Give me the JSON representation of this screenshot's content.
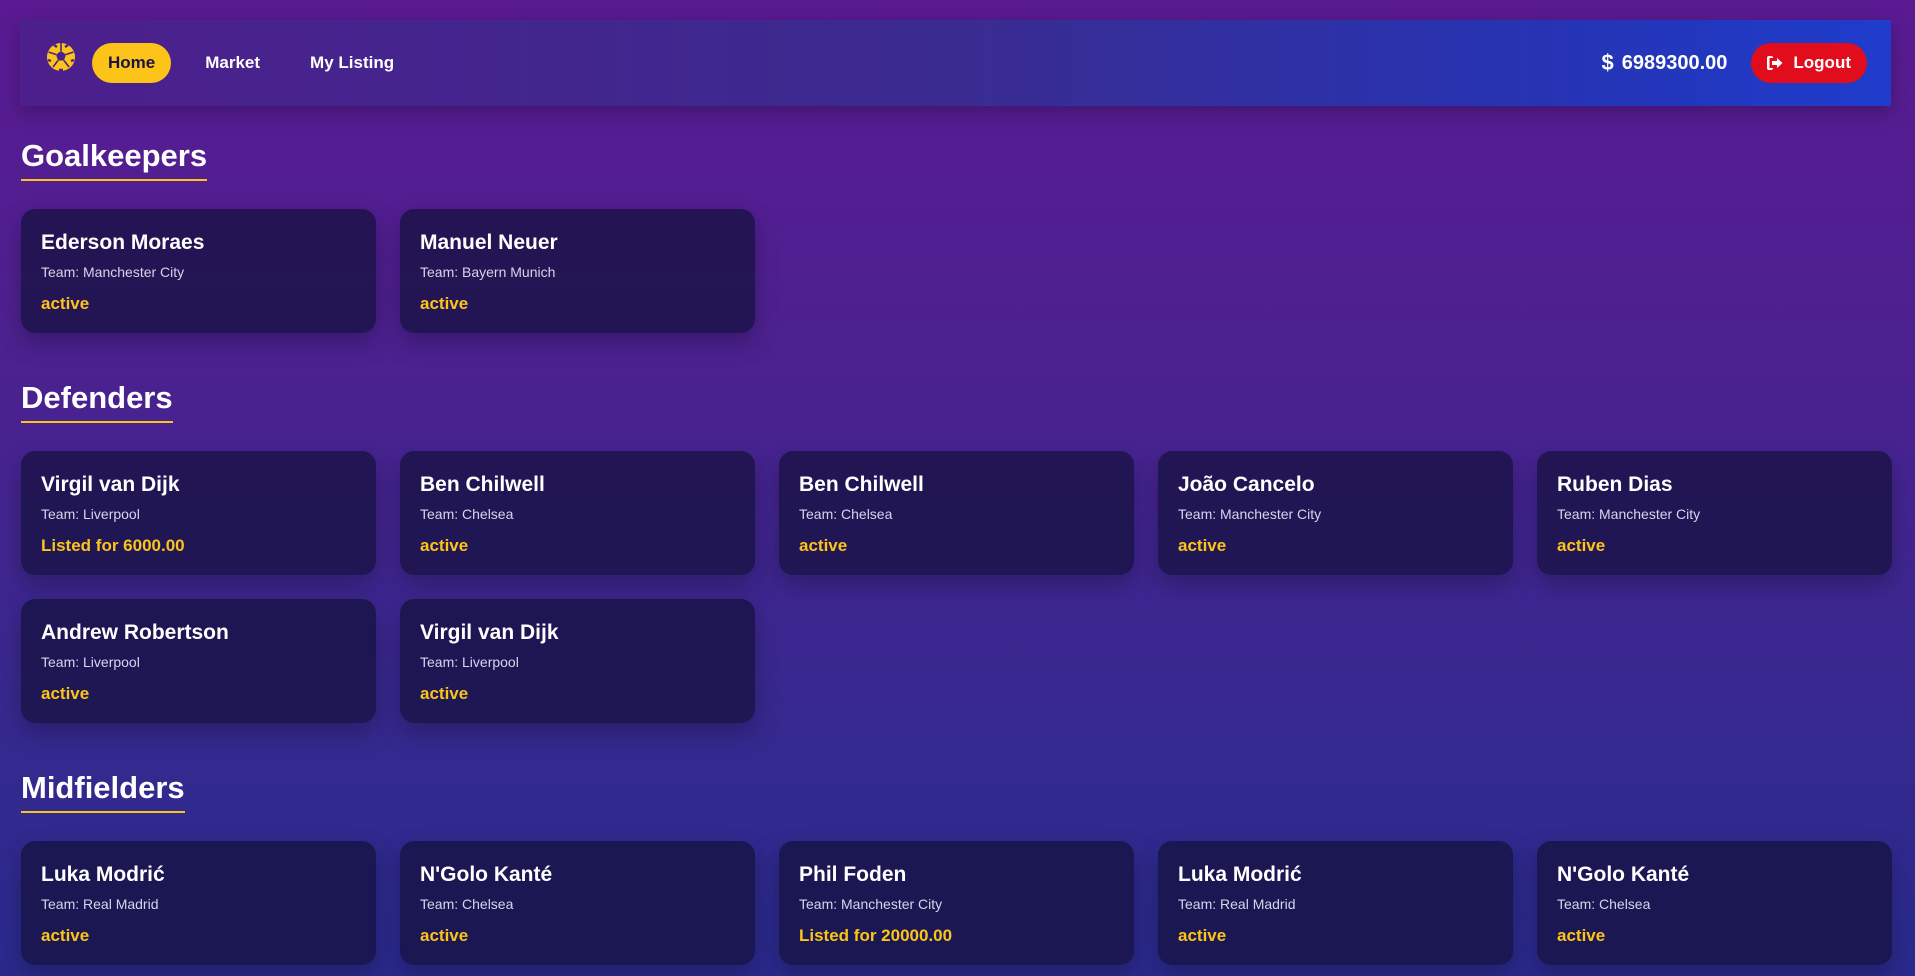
{
  "nav": {
    "logo_icon": "soccer-ball-icon",
    "links": [
      {
        "label": "Home",
        "active": true
      },
      {
        "label": "Market",
        "active": false
      },
      {
        "label": "My Listing",
        "active": false
      }
    ],
    "balance": "6989300.00",
    "balance_currency": "$",
    "logout_label": "Logout",
    "logout_icon": "sign-out-icon"
  },
  "colors": {
    "accent": "#fcc419",
    "logout": "#e10d1c"
  },
  "sections": [
    {
      "title": "Goalkeepers",
      "players": [
        {
          "name": "Ederson Moraes",
          "team": "Team: Manchester City",
          "status": "active"
        },
        {
          "name": "Manuel Neuer",
          "team": "Team: Bayern Munich",
          "status": "active"
        }
      ]
    },
    {
      "title": "Defenders",
      "players": [
        {
          "name": "Virgil van Dijk",
          "team": "Team: Liverpool",
          "status": "Listed for 6000.00"
        },
        {
          "name": "Ben Chilwell",
          "team": "Team: Chelsea",
          "status": "active"
        },
        {
          "name": "Ben Chilwell",
          "team": "Team: Chelsea",
          "status": "active"
        },
        {
          "name": "João Cancelo",
          "team": "Team: Manchester City",
          "status": "active"
        },
        {
          "name": "Ruben Dias",
          "team": "Team: Manchester City",
          "status": "active"
        },
        {
          "name": "Andrew Robertson",
          "team": "Team: Liverpool",
          "status": "active"
        },
        {
          "name": "Virgil van Dijk",
          "team": "Team: Liverpool",
          "status": "active"
        }
      ]
    },
    {
      "title": "Midfielders",
      "players": [
        {
          "name": "Luka Modrić",
          "team": "Team: Real Madrid",
          "status": "active"
        },
        {
          "name": "N'Golo Kanté",
          "team": "Team: Chelsea",
          "status": "active"
        },
        {
          "name": "Phil Foden",
          "team": "Team: Manchester City",
          "status": "Listed for 20000.00"
        },
        {
          "name": "Luka Modrić",
          "team": "Team: Real Madrid",
          "status": "active"
        },
        {
          "name": "N'Golo Kanté",
          "team": "Team: Chelsea",
          "status": "active"
        }
      ]
    }
  ]
}
